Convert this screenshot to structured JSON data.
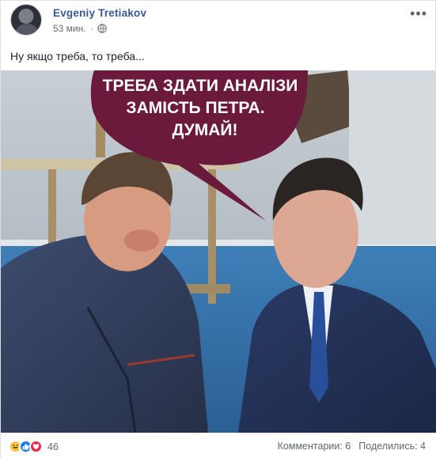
{
  "post": {
    "author": "Evgeniy Tretiakov",
    "time": "53 мин.",
    "separator": "·",
    "privacy_icon": "globe-icon",
    "more_icon": "more-options-icon",
    "more_glyph": "•••",
    "text": "Ну якщо треба, то треба..."
  },
  "meme": {
    "caption_lines": [
      "ТРЕБА ЗДАТИ АНАЛІЗИ",
      "ЗАМІСТЬ ПЕТРА.",
      "ДУМАЙ!"
    ],
    "bubble_color": "#6b1a3c"
  },
  "footer": {
    "reaction_icons": [
      "haha-icon",
      "like-icon",
      "love-icon"
    ],
    "reaction_count": "46",
    "comments": "Комментарии: 6",
    "shares": "Поделились: 4"
  },
  "colors": {
    "link": "#385898",
    "secondary_text": "#616770",
    "border": "#dddfe2"
  }
}
